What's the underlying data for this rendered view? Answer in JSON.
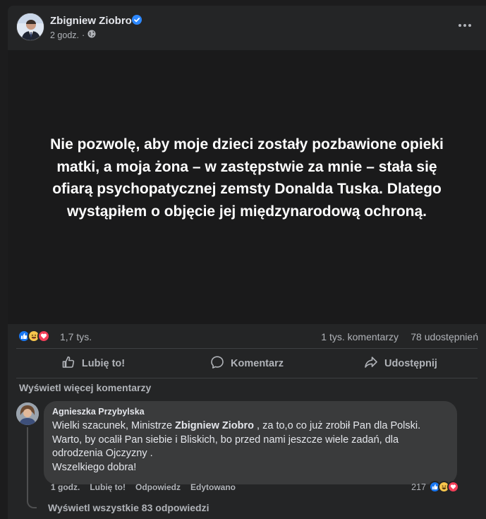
{
  "post": {
    "author": "Zbigniew Ziobro",
    "time": "2 godz.",
    "separator": "·",
    "quote": "Nie pozwolę, aby moje dzieci zostały pozbawione opieki matki, a moja żona – w zastępstwie za mnie – stała się ofiarą psychopatycznej zemsty Donalda Tuska. Dlatego wystąpiłem o objęcie jej międzynarodową ochroną.",
    "reaction_icons": [
      "like-icon",
      "haha-icon",
      "love-icon"
    ],
    "reaction_count": "1,7 tys.",
    "comments_count": "1 tys. komentarzy",
    "shares_count": "78 udostępnień"
  },
  "actions": {
    "like": "Lubię to!",
    "comment": "Komentarz",
    "share": "Udostępnij"
  },
  "comments": {
    "more_link": "Wyświetl więcej komentarzy",
    "item": {
      "author": "Agnieszka Przybylska",
      "text_before": "Wielki szacunek, Ministrze ",
      "mention": "Zbigniew Ziobro",
      "text_after": " , za to,o co już zrobił Pan dla Polski.",
      "line2": "Warto, by ocalił Pan siebie i Bliskich, bo przed nami jeszcze wiele zadań, dla odrodzenia Ojczyzny .",
      "line3": "Wszelkiego dobra!",
      "time": "1 godz.",
      "like": "Lubię to!",
      "reply": "Odpowiedz",
      "edited": "Edytowano",
      "reaction_count": "217"
    },
    "view_replies": "Wyświetl wszystkie 83 odpowiedzi"
  },
  "colors": {
    "page_bg": "#1c1c1d",
    "card_bg": "#242526",
    "image_bg": "#1a1a1b",
    "bubble_bg": "#3a3b3c",
    "verified": "#2d88ff",
    "like": "#1877f2",
    "haha": "#f7c54c",
    "love": "#f33e58"
  }
}
